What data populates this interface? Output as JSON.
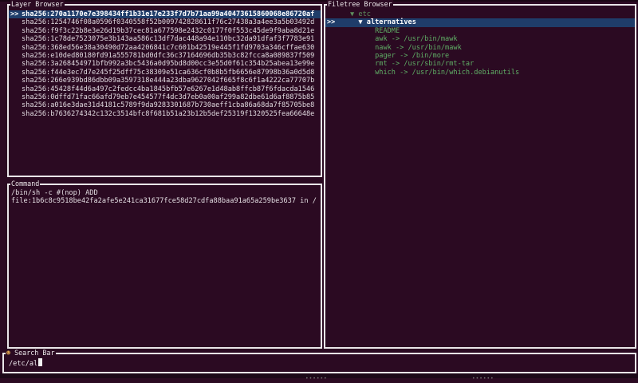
{
  "layer_browser": {
    "title": "Layer Browser",
    "cursor": ">>",
    "layers": [
      "sha256:270a1170e7e398434ff1b31e17e233f7d7b71aa99a40473615860068e86720af",
      "sha256:1254746f08a0596f0340558f52b009742828611f76c27438a3a4ee3a5b03492d",
      "sha256:f9f3c22b8e3e26d19b37cec81a677598e2432c0177f0f553c45de9f9aba8d21e",
      "sha256:1c78de7523075e3b143aa586c13df7dac448a94e110bc32da91dfaf3f7783e91",
      "sha256:368ed56e38a30490d72aa4206841c7c601b42519e445f1fd9703a346cffae630",
      "sha256:e10ded80180fd91a555781bd0dfc36c37164696db35b3c82fcca8a089837f509",
      "sha256:3a268454971bfb992a3bc5436a0d95bd8d00cc3e55d0f61c354b25abea13e99e",
      "sha256:f44e3ec7d7e245f25dff75c38309e51ca636cf0b8b5fb6656e87998b36a0d5d8",
      "sha256:266e939bd86dbb09a3597318e444a23dba9627042f665f8c6f1a4222ca77707b",
      "sha256:45428f44d6a497c2fedcc4ba1845bfb57e6267e1d48ab8ffcb87f6fdacda1546",
      "sha256:0dffd71fac66afd79eb7e454577f4dc3d7eb0a00af299a82dbe61d6af8875b85",
      "sha256:a016e3dae31d4181c5789f9da9283301687b730aeff1cba86a68da7f85705be8",
      "sha256:b7636274342c132c3514bfc8f681b51a23b12b5def25319f1320525fea66648e"
    ],
    "selected_index": 0
  },
  "command": {
    "title": "Command",
    "line1": "/bin/sh -c #(nop) ADD",
    "line2": "file:1b6c8c9518be42fa2afe5e241ca31677fce58d27cdfa88baa91a65a259be3637 in /"
  },
  "filetree": {
    "title": "Filetree Browser",
    "cursor": ">>",
    "rows": [
      {
        "indent": "   ",
        "arrow": "▼",
        "text": "etc",
        "color": "#5e8f5e",
        "selected": false
      },
      {
        "indent": "     ",
        "arrow": "▼",
        "text": "alternatives",
        "color": "#ffffff",
        "selected": true
      },
      {
        "indent": "         ",
        "arrow": "",
        "text": "README",
        "color": "#5fae65",
        "selected": false
      },
      {
        "indent": "         ",
        "arrow": "",
        "text": "awk -> /usr/bin/mawk",
        "color": "#5fae65",
        "selected": false
      },
      {
        "indent": "         ",
        "arrow": "",
        "text": "nawk -> /usr/bin/mawk",
        "color": "#5fae65",
        "selected": false
      },
      {
        "indent": "         ",
        "arrow": "",
        "text": "pager -> /bin/more",
        "color": "#5fae65",
        "selected": false
      },
      {
        "indent": "         ",
        "arrow": "",
        "text": "rmt -> /usr/sbin/rmt-tar",
        "color": "#5fae65",
        "selected": false
      },
      {
        "indent": "         ",
        "arrow": "",
        "text": "which -> /usr/bin/which.debianutils",
        "color": "#5fae65",
        "selected": false
      }
    ]
  },
  "search": {
    "title": "Search Bar",
    "icon": "search-emoji-icon",
    "value": "/etc/al"
  },
  "colors": {
    "background": "#2b0a22",
    "selection": "#1f3d6a",
    "border": "#e9e5e8",
    "file_green": "#5fae65",
    "dir_dim": "#5e8f5e"
  }
}
